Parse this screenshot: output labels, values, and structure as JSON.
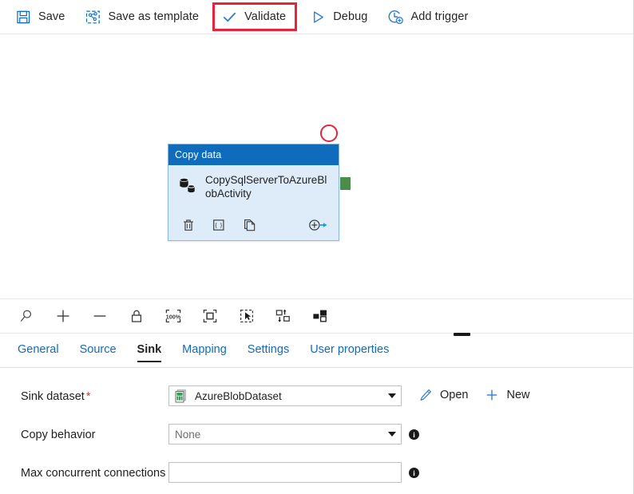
{
  "colors": {
    "accent": "#0f6cbd",
    "node_header": "#0f6cbd",
    "node_body": "#deecf9",
    "annotation_red": "#e6243b",
    "port_green": "#4a8c4a",
    "required_red": "#d13438"
  },
  "toolbar": {
    "items": [
      {
        "label": "Save",
        "icon": "save-icon",
        "highlighted": false
      },
      {
        "label": "Save as template",
        "icon": "save-as-template-icon",
        "highlighted": false
      },
      {
        "label": "Validate",
        "icon": "checkmark-icon",
        "highlighted": true
      },
      {
        "label": "Debug",
        "icon": "play-triangle-icon",
        "highlighted": false
      },
      {
        "label": "Add trigger",
        "icon": "add-trigger-icon",
        "highlighted": false
      }
    ]
  },
  "canvas": {
    "node": {
      "header": "Copy data",
      "title": "CopySqlServerToAzureBlobActivity",
      "icon": "copy-data-databases-icon",
      "actions": [
        {
          "name": "delete-activity-icon",
          "glyph": "trash"
        },
        {
          "name": "code-activity-icon",
          "glyph": "braces"
        },
        {
          "name": "clone-activity-icon",
          "glyph": "copy"
        },
        {
          "name": "add-output-icon",
          "glyph": "plus-arrow"
        }
      ],
      "output_port": "success-output-port"
    },
    "annotation": "red-circle-highlight"
  },
  "canvas_tools": {
    "items": [
      {
        "name": "zoom-tool-icon",
        "title": "Zoom"
      },
      {
        "name": "zoom-in-icon",
        "title": "Zoom in"
      },
      {
        "name": "zoom-out-icon",
        "title": "Zoom out"
      },
      {
        "name": "lock-canvas-icon",
        "title": "Lock"
      },
      {
        "name": "zoom-100-percent-icon",
        "title": "100%"
      },
      {
        "name": "zoom-to-fit-icon",
        "title": "Zoom to fit"
      },
      {
        "name": "select-mode-icon",
        "title": "Select"
      },
      {
        "name": "auto-align-icon",
        "title": "Auto align"
      },
      {
        "name": "layout-icon",
        "title": "Layout"
      }
    ],
    "zoom_level": "100%"
  },
  "tabs": {
    "items": [
      {
        "label": "General",
        "active": false
      },
      {
        "label": "Source",
        "active": false
      },
      {
        "label": "Sink",
        "active": true
      },
      {
        "label": "Mapping",
        "active": false
      },
      {
        "label": "Settings",
        "active": false
      },
      {
        "label": "User properties",
        "active": false
      }
    ]
  },
  "form": {
    "sink_dataset": {
      "label": "Sink dataset",
      "required_marker": "*",
      "value": "AzureBlobDataset",
      "icon": "dataset-file-icon",
      "open_label": "Open",
      "open_icon": "pencil-icon",
      "new_label": "New",
      "new_icon": "plus-icon"
    },
    "copy_behavior": {
      "label": "Copy behavior",
      "value": "None",
      "info": "i"
    },
    "max_concurrent_connections": {
      "label": "Max concurrent connections",
      "value": "",
      "placeholder": "",
      "info": "i"
    }
  }
}
